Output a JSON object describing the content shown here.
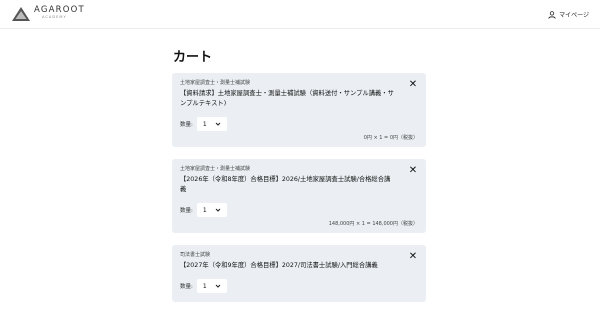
{
  "header": {
    "logo_main": "AGAROOT",
    "logo_sub": "ACADEMY",
    "mypage_label": "マイページ"
  },
  "page_title": "カート",
  "close_glyph": "✕",
  "items": [
    {
      "category": "土地家屋調査士・測量士補試験",
      "title": "【資料請求】土地家屋調査士・測量士補試験（資料送付・サンプル講義・サンプルテキスト)",
      "qty_label": "数量:",
      "qty_value": "1",
      "price": "0円 × 1 = 0円（税抜）"
    },
    {
      "category": "土地家屋調査士・測量士補試験",
      "title": "【2026年（令和8年度）合格目標】2026/土地家屋調査士試験/合格総合講義",
      "qty_label": "数量:",
      "qty_value": "1",
      "price": "148,000円 × 1 = 148,000円（税抜）"
    },
    {
      "category": "司法書士試験",
      "title": "【2027年（令和9年度）合格目標】2027/司法書士試験/入門総合講義",
      "qty_label": "数量:",
      "qty_value": "1",
      "price": ""
    }
  ]
}
